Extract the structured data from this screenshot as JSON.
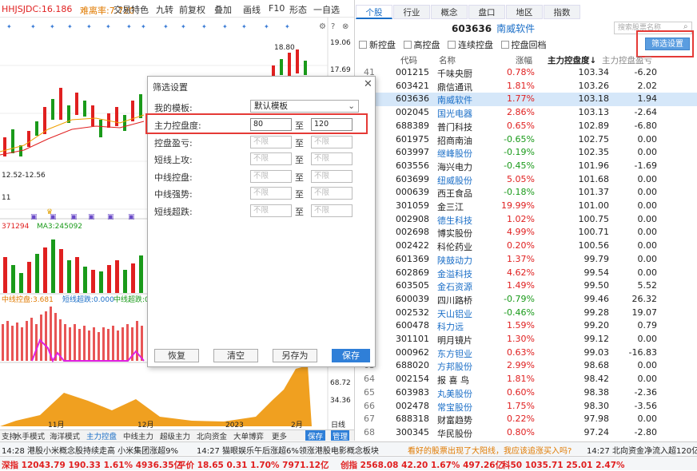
{
  "toolbar": {
    "ma_items": [
      {
        "text": "HHJSJDC:16.186",
        "color": "#e02020"
      },
      {
        "text": "难离率:7.720",
        "color": "#e07a00"
      }
    ],
    "tools": [
      "交易特色",
      "九转",
      "前复权",
      "叠加",
      "画线",
      "F10",
      "形态",
      "一自选"
    ]
  },
  "chart": {
    "price_high": "18.80",
    "y_labels": [
      "19.06",
      "17.69",
      "12.52-12.56",
      "11"
    ],
    "vol_indicator": "371294",
    "vol_ma": "MA3:245092",
    "ctrl_labels": [
      {
        "text": "中线控盘:3.681",
        "color": "#e07a00"
      },
      {
        "text": "短线超跌:0.000",
        "color": "#1a6ec7"
      },
      {
        "text": "中线超跌:0...",
        "color": "#1a9a1a"
      }
    ],
    "bottom_y": [
      "68.72",
      "34.36"
    ],
    "x_labels": [
      "11月",
      "12月",
      "2023",
      "2月"
    ],
    "period": "日线"
  },
  "bottom_tabs": [
    "支持",
    "水手模式",
    "海洋模式",
    "主力控盘",
    "中线主力",
    "超级主力",
    "北向资金",
    "大单博弈",
    "更多",
    "保存",
    "管理"
  ],
  "right": {
    "tabs": [
      "个股",
      "行业",
      "概念",
      "盘口",
      "地区",
      "指数"
    ],
    "active_tab": "个股",
    "code": "603636",
    "code_name": "南威软件",
    "search_placeholder": "搜索股票名称",
    "filters": [
      "新控盘",
      "高控盘",
      "连续控盘",
      "控盘回档"
    ],
    "filter_button": "筛选设置",
    "columns": [
      "代码",
      "名称",
      "涨幅",
      "主力控盘度↓",
      "主力控盘盈亏"
    ],
    "rows": [
      {
        "idx": "41",
        "code": "001215",
        "name": "千味央厨",
        "chg": "0.78%",
        "val": "103.34",
        "net": "-6.20",
        "dir": "up",
        "link": false
      },
      {
        "idx": "42",
        "code": "603421",
        "name": "鼎信通讯",
        "chg": "1.81%",
        "val": "103.26",
        "net": "2.02",
        "dir": "up",
        "link": false
      },
      {
        "idx": "43",
        "code": "603636",
        "name": "南威软件",
        "chg": "1.77%",
        "val": "103.18",
        "net": "1.94",
        "dir": "up",
        "link": true,
        "sel": true
      },
      {
        "idx": "44",
        "code": "002045",
        "name": "国光电器",
        "chg": "2.86%",
        "val": "103.13",
        "net": "-2.64",
        "dir": "up",
        "link": true
      },
      {
        "idx": "45",
        "code": "688389",
        "name": "普门科技",
        "chg": "0.65%",
        "val": "102.89",
        "net": "-6.80",
        "dir": "up",
        "link": false
      },
      {
        "idx": "46",
        "code": "601975",
        "name": "招商南油",
        "chg": "-0.65%",
        "val": "102.75",
        "net": "0.00",
        "dir": "dn",
        "link": false
      },
      {
        "idx": "47",
        "code": "603997",
        "name": "继峰股份",
        "chg": "-0.19%",
        "val": "102.35",
        "net": "0.00",
        "dir": "dn",
        "link": true
      },
      {
        "idx": "48",
        "code": "603556",
        "name": "海兴电力",
        "chg": "-0.45%",
        "val": "101.96",
        "net": "-1.69",
        "dir": "dn",
        "link": false
      },
      {
        "idx": "49",
        "code": "603699",
        "name": "纽威股份",
        "chg": "5.05%",
        "val": "101.68",
        "net": "0.00",
        "dir": "up",
        "link": true
      },
      {
        "idx": "50",
        "code": "000639",
        "name": "西王食品",
        "chg": "-0.18%",
        "val": "101.37",
        "net": "0.00",
        "dir": "dn",
        "link": false
      },
      {
        "idx": "51",
        "code": "301059",
        "name": "金三江",
        "chg": "19.99%",
        "val": "101.00",
        "net": "0.00",
        "dir": "up",
        "link": false
      },
      {
        "idx": "52",
        "code": "002908",
        "name": "德生科技",
        "chg": "1.02%",
        "val": "100.75",
        "net": "0.00",
        "dir": "up",
        "link": true
      },
      {
        "idx": "53",
        "code": "002698",
        "name": "博实股份",
        "chg": "4.99%",
        "val": "100.71",
        "net": "0.00",
        "dir": "up",
        "link": false
      },
      {
        "idx": "54",
        "code": "002422",
        "name": "科伦药业",
        "chg": "0.20%",
        "val": "100.56",
        "net": "0.00",
        "dir": "up",
        "link": false
      },
      {
        "idx": "55",
        "code": "601369",
        "name": "陕鼓动力",
        "chg": "1.37%",
        "val": "99.79",
        "net": "0.00",
        "dir": "up",
        "link": true
      },
      {
        "idx": "56",
        "code": "602869",
        "name": "金溢科技",
        "chg": "4.62%",
        "val": "99.54",
        "net": "0.00",
        "dir": "up",
        "link": true
      },
      {
        "idx": "57",
        "code": "603505",
        "name": "金石资源",
        "chg": "1.49%",
        "val": "99.50",
        "net": "5.52",
        "dir": "up",
        "link": true
      },
      {
        "idx": "58",
        "code": "600039",
        "name": "四川路桥",
        "chg": "-0.79%",
        "val": "99.46",
        "net": "26.32",
        "dir": "dn",
        "link": false
      },
      {
        "idx": "59",
        "code": "002532",
        "name": "天山铝业",
        "chg": "-0.46%",
        "val": "99.28",
        "net": "19.07",
        "dir": "dn",
        "link": true
      },
      {
        "idx": "60",
        "code": "600478",
        "name": "科力远",
        "chg": "1.59%",
        "val": "99.20",
        "net": "0.79",
        "dir": "up",
        "link": true
      },
      {
        "idx": "61",
        "code": "301101",
        "name": "明月镜片",
        "chg": "1.30%",
        "val": "99.12",
        "net": "0.00",
        "dir": "up",
        "link": false
      },
      {
        "idx": "62",
        "code": "000962",
        "name": "东方钽业",
        "chg": "0.63%",
        "val": "99.03",
        "net": "-16.83",
        "dir": "up",
        "link": true
      },
      {
        "idx": "63",
        "code": "688020",
        "name": "方邦股份",
        "chg": "2.99%",
        "val": "98.68",
        "net": "0.00",
        "dir": "up",
        "link": true
      },
      {
        "idx": "64",
        "code": "002154",
        "name": "报 喜 鸟",
        "chg": "1.81%",
        "val": "98.42",
        "net": "0.00",
        "dir": "up",
        "link": false
      },
      {
        "idx": "65",
        "code": "603983",
        "name": "丸美股份",
        "chg": "0.60%",
        "val": "98.38",
        "net": "-2.36",
        "dir": "up",
        "link": true
      },
      {
        "idx": "66",
        "code": "002478",
        "name": "常宝股份",
        "chg": "1.75%",
        "val": "98.30",
        "net": "-3.56",
        "dir": "up",
        "link": true
      },
      {
        "idx": "67",
        "code": "688318",
        "name": "财富趋势",
        "chg": "0.22%",
        "val": "97.98",
        "net": "0.00",
        "dir": "up",
        "link": false
      },
      {
        "idx": "68",
        "code": "300345",
        "name": "华民股份",
        "chg": "0.80%",
        "val": "97.24",
        "net": "-2.80",
        "dir": "up",
        "link": false
      }
    ]
  },
  "dialog": {
    "title": "筛选设置",
    "template_label": "我的模板:",
    "template_value": "默认模板",
    "range_sep": "至",
    "placeholder": "不限",
    "fields": [
      {
        "label": "主力控盘度:",
        "from": "80",
        "to": "120",
        "active": true
      },
      {
        "label": "控盘盈亏:",
        "from": "",
        "to": "",
        "active": false
      },
      {
        "label": "短线上攻:",
        "from": "",
        "to": "",
        "active": false
      },
      {
        "label": "中线控盘:",
        "from": "",
        "to": "",
        "active": false
      },
      {
        "label": "中线强势:",
        "from": "",
        "to": "",
        "active": false
      },
      {
        "label": "短线超跌:",
        "from": "",
        "to": "",
        "active": false
      }
    ],
    "buttons": {
      "restore": "恢复",
      "clear": "清空",
      "save_as": "另存为",
      "save": "保存"
    }
  },
  "ticker": [
    {
      "text": "14:28 港股小米概念股持续走高 小米集团涨超9%",
      "color": "#222"
    },
    {
      "text": "14:27 猫眼娱乐午后涨超6%领涨港股电影概念板块",
      "color": "#222"
    },
    {
      "text": "看好的股票出现了大阳线，我应该追涨买入吗?",
      "color": "#e07a00"
    },
    {
      "text": "14:27 北向资金净流入超120亿",
      "color": "#222"
    }
  ],
  "status": [
    {
      "text": "深指 12043.79  190.33  1.61%  4936.35亿",
      "color": "#e02020"
    },
    {
      "text": "平价 18.65  0.31  1.70%  7971.12亿",
      "color": "#e02020"
    },
    {
      "text": "创指 2568.08  42.20  1.67%  497.26亿",
      "color": "#e02020"
    },
    {
      "text": "科50 1035.71  25.01  2.47%",
      "color": "#e02020"
    }
  ]
}
